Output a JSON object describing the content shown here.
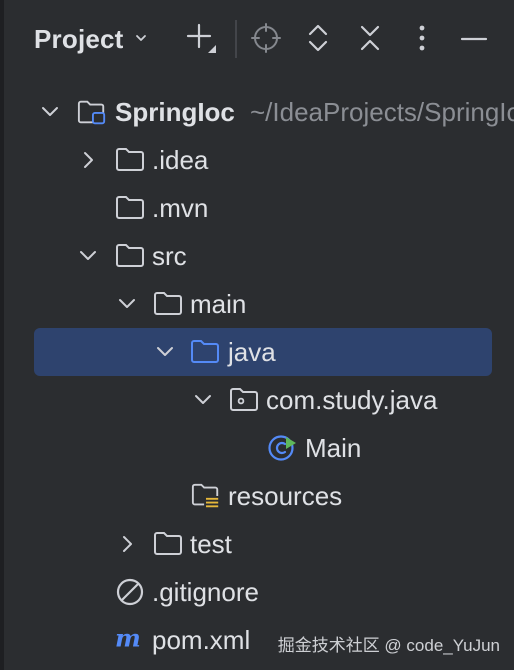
{
  "panel": {
    "title": "Project"
  },
  "toolbar": {
    "icons": [
      "chevron-down-icon",
      "add-icon",
      "locate-icon",
      "expand-all-icon",
      "collapse-all-icon",
      "more-options-icon",
      "hide-icon"
    ]
  },
  "tree": {
    "root": {
      "label": "SpringIoc",
      "path": "~/IdeaProjects/SpringIoc"
    },
    "idea": "idea_placeholder",
    "items": {
      "idea": ".idea",
      "mvn": ".mvn",
      "src": "src",
      "main": "main",
      "java": "java",
      "package": "com.study.java",
      "main_class": "Main",
      "resources": "resources",
      "test": "test",
      "gitignore": ".gitignore",
      "pom": "pom.xml"
    }
  },
  "watermark": "掘金技术社区 @ code_YuJun",
  "colors": {
    "background": "#2b2d30",
    "selection": "#2e436e",
    "text": "#dfe1e5",
    "muted": "#8b8e94",
    "icon": "#ced0d6",
    "accent_blue": "#548af7",
    "resource_yellow": "#e6b83a"
  }
}
